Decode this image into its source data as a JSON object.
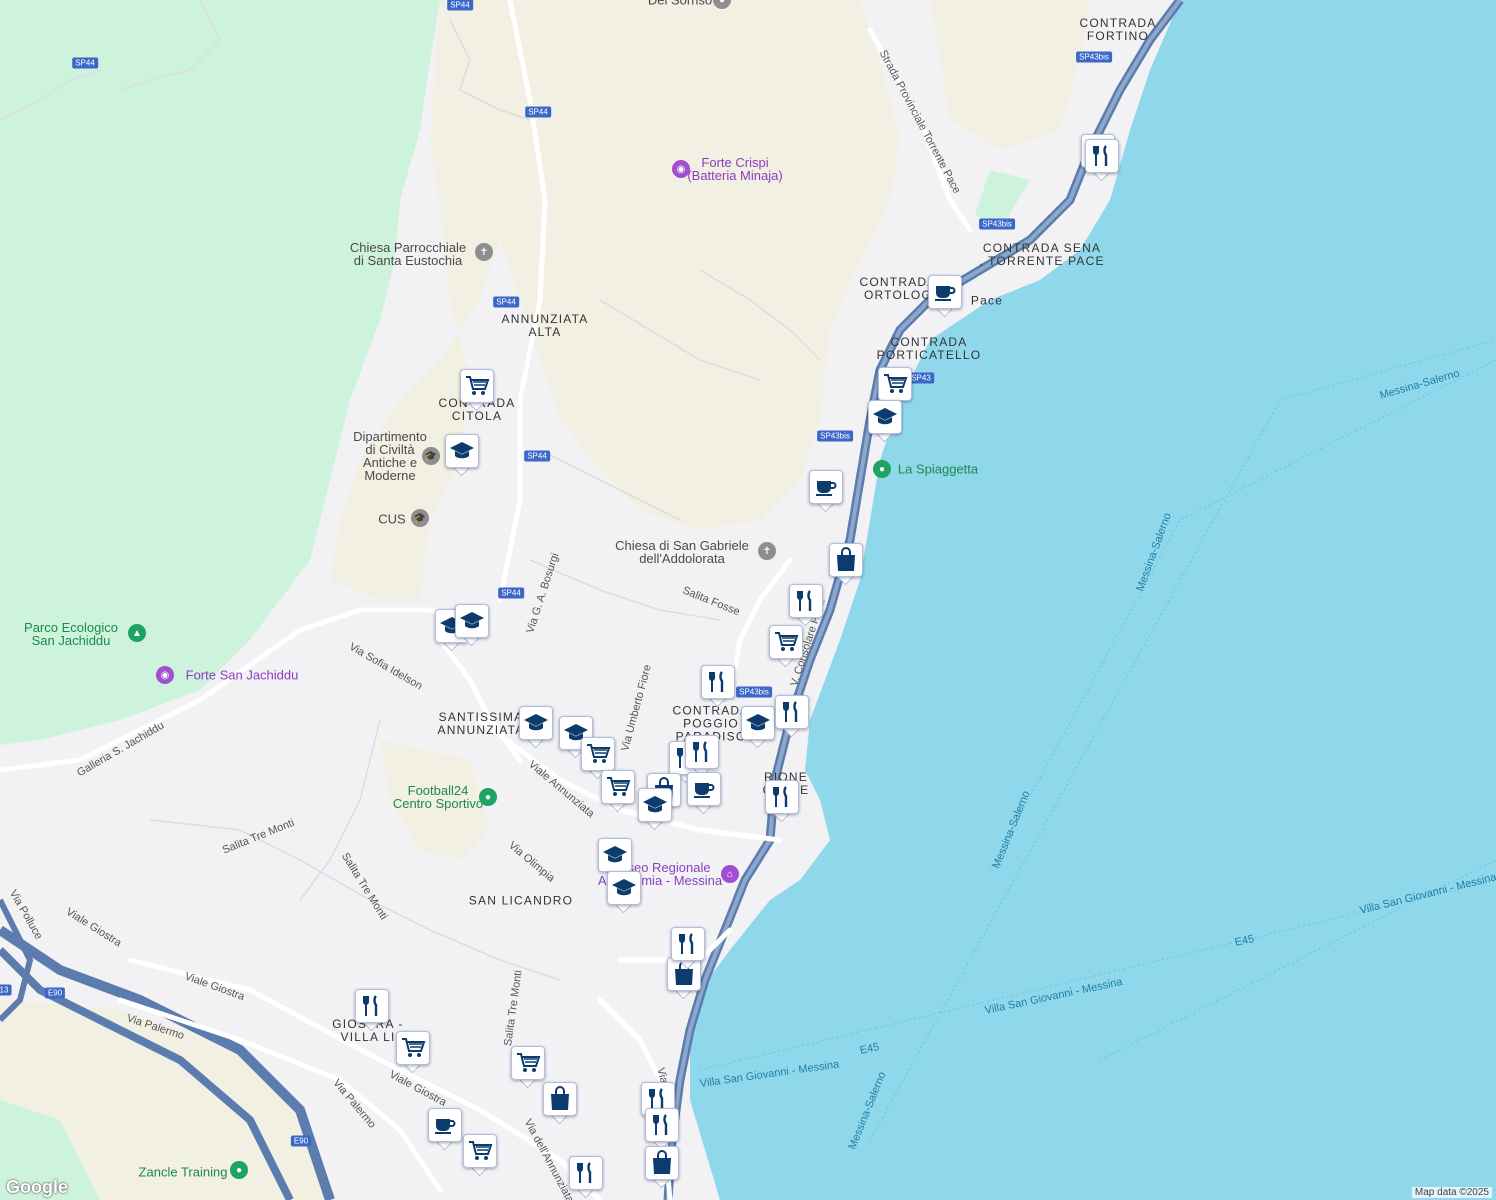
{
  "colors": {
    "sea": "#8fd8ec",
    "forest": "#cdf3dc",
    "sand": "#f2efe3",
    "urban": "#f2f2f5",
    "road": "#ffffff",
    "highway": "#5b7cad",
    "highway_core": "#8ea7cc",
    "marker_icon": "#0d3b6e",
    "badge": "#3a67c8"
  },
  "area_labels": [
    {
      "text": "CONTRADA\nFORTINO"
    },
    {
      "text": "CONTRADA SENA\n, TORRENTE PACE"
    },
    {
      "text": "CONTRADA\nORTOLOG"
    },
    {
      "text": "Pace"
    },
    {
      "text": "CONTRADA\nPORTICATELLO"
    },
    {
      "text": "ANNUNZIATA\nALTA"
    },
    {
      "text": "CONTRADA\nCITOLA"
    },
    {
      "text": "SANTISSIMA\nANNUNZIATA"
    },
    {
      "text": "CONTRADA\nPOGGIO\nPARADISO"
    },
    {
      "text": "RIONE\nCASSE"
    },
    {
      "text": "SAN LICANDRO"
    },
    {
      "text": "GIOSTRA -\nVILLA LI"
    }
  ],
  "poi_labels": [
    {
      "text": "Forte Crispi\n(Batteria Minaja)",
      "kind": "purple",
      "icon": "camera-icon"
    },
    {
      "text": "Chiesa Parrocchiale\ndi Santa Eustochia",
      "kind": "gray",
      "icon": "church-icon"
    },
    {
      "text": "Dipartimento\ndi Civiltà\nAntiche e\nModerne",
      "kind": "gray",
      "icon": "school-icon"
    },
    {
      "text": "CUS",
      "kind": "gray",
      "icon": "school-icon"
    },
    {
      "text": "Chiesa di San Gabriele\ndell'Addolorata",
      "kind": "gray",
      "icon": "church-icon"
    },
    {
      "text": "La Spiaggetta",
      "kind": "green",
      "icon": "pin-icon"
    },
    {
      "text": "Parco Ecologico\nSan Jachiddu",
      "kind": "green",
      "icon": "tree-icon"
    },
    {
      "text": "Forte San Jachiddu",
      "kind": "purple",
      "icon": "camera-icon"
    },
    {
      "text": "Football24\nCentro Sportivo",
      "kind": "green",
      "icon": "pin-icon"
    },
    {
      "text": "Museo Regionale\nAccademia - Messina",
      "kind": "purple",
      "icon": "museum-icon"
    },
    {
      "text": "Zancle Training",
      "kind": "green",
      "icon": "pin-icon"
    },
    {
      "text": "Del Sorriso",
      "kind": "gray",
      "icon": "pin-icon"
    }
  ],
  "road_labels": [
    {
      "text": "Strada Provinciale Torrente Pace"
    },
    {
      "text": "Via G. A. Bosurgi"
    },
    {
      "text": "Salita Fosse"
    },
    {
      "text": "Via Sofia Idelson"
    },
    {
      "text": "Via Umberto Fiore"
    },
    {
      "text": "V. Consolare Pom."
    },
    {
      "text": "Viale Annunziata"
    },
    {
      "text": "Galleria S. Jachiddu"
    },
    {
      "text": "Salita Tre Monti"
    },
    {
      "text": "Salita Tre Monti"
    },
    {
      "text": "Via Olimpia"
    },
    {
      "text": "Via Polluce"
    },
    {
      "text": "Viale Giostra"
    },
    {
      "text": "Viale Giostra"
    },
    {
      "text": "Via Palermo"
    },
    {
      "text": "Via Palermo"
    },
    {
      "text": "Viale Giostra"
    },
    {
      "text": "Via dell'Annunziata"
    },
    {
      "text": "Salita Tre Monti"
    },
    {
      "text": "Via"
    }
  ],
  "sea_labels": [
    {
      "text": "Messina-Salerno"
    },
    {
      "text": "Messina-Salerno"
    },
    {
      "text": "Messina-Salerno"
    },
    {
      "text": "Messina-Salerno"
    },
    {
      "text": "Villa San Giovanni - Messina"
    },
    {
      "text": "Villa San Giovanni - Messina"
    },
    {
      "text": "Villa San Giovanni - Messina"
    },
    {
      "text": "E45"
    },
    {
      "text": "E45"
    }
  ],
  "road_badges": [
    "SP44",
    "SP44",
    "SP44",
    "SP44",
    "SP44",
    "SP44",
    "SP43bis",
    "SP43bis",
    "SP43",
    "SP43bis",
    "SP43bis",
    "E90",
    "E90",
    "13"
  ],
  "markers": [
    {
      "icon": "coffee-icon"
    },
    {
      "icon": "restaurant-icon"
    },
    {
      "icon": "coffee-icon"
    },
    {
      "icon": "shopping-cart-icon"
    },
    {
      "icon": "school-icon"
    },
    {
      "icon": "coffee-icon"
    },
    {
      "icon": "shopping-bag-icon"
    },
    {
      "icon": "restaurant-icon"
    },
    {
      "icon": "shopping-cart-icon"
    },
    {
      "icon": "restaurant-icon"
    },
    {
      "icon": "school-icon"
    },
    {
      "icon": "restaurant-icon"
    },
    {
      "icon": "shopping-cart-icon"
    },
    {
      "icon": "school-icon"
    },
    {
      "icon": "school-icon"
    },
    {
      "icon": "school-icon"
    },
    {
      "icon": "school-icon"
    },
    {
      "icon": "school-icon"
    },
    {
      "icon": "shopping-cart-icon"
    },
    {
      "icon": "shopping-cart-icon"
    },
    {
      "icon": "restaurant-icon"
    },
    {
      "icon": "restaurant-icon"
    },
    {
      "icon": "shopping-bag-icon"
    },
    {
      "icon": "coffee-icon"
    },
    {
      "icon": "school-icon"
    },
    {
      "icon": "restaurant-icon"
    },
    {
      "icon": "school-icon"
    },
    {
      "icon": "school-icon"
    },
    {
      "icon": "shopping-bag-icon"
    },
    {
      "icon": "restaurant-icon"
    },
    {
      "icon": "restaurant-icon"
    },
    {
      "icon": "shopping-cart-icon"
    },
    {
      "icon": "shopping-cart-icon"
    },
    {
      "icon": "shopping-bag-icon"
    },
    {
      "icon": "coffee-icon"
    },
    {
      "icon": "shopping-cart-icon"
    },
    {
      "icon": "restaurant-icon"
    },
    {
      "icon": "restaurant-icon"
    },
    {
      "icon": "shopping-bag-icon"
    },
    {
      "icon": "restaurant-icon"
    }
  ],
  "attribution": "Map data ©2025",
  "logo": "Google"
}
